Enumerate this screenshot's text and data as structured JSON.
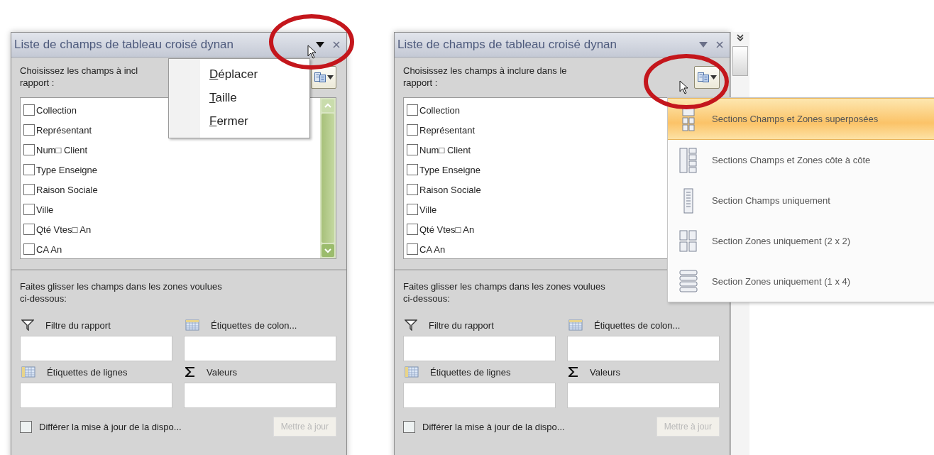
{
  "panels": [
    {
      "title": "Liste de champs de tableau croisé dynan",
      "intro_lines": [
        "Choisissez les champs à incl",
        "rapport :"
      ],
      "fields": [
        {
          "label": "Collection",
          "checked": false
        },
        {
          "label": "Représentant",
          "checked": false
        },
        {
          "label": "Num□ Client",
          "checked": false
        },
        {
          "label": "Type Enseigne",
          "checked": false
        },
        {
          "label": "Raison Sociale",
          "checked": false
        },
        {
          "label": "Ville",
          "checked": false
        },
        {
          "label": "Qté Vtes□ An",
          "checked": false
        },
        {
          "label": "CA An",
          "checked": false
        }
      ],
      "drag_hint_lines": [
        "Faites glisser les champs dans les zones voulues",
        "ci-dessous:"
      ],
      "zones": [
        {
          "kind": "filter",
          "label": "Filtre du rapport"
        },
        {
          "kind": "columns",
          "label": "Étiquettes de colon..."
        },
        {
          "kind": "rows",
          "label": "Étiquettes de lignes"
        },
        {
          "kind": "values",
          "label": "Valeurs"
        }
      ],
      "defer": {
        "label": "Différer la mise à jour de la dispo...",
        "checked": false
      },
      "update_button": {
        "label": "Mettre à jour",
        "disabled": true
      },
      "menu": {
        "kind": "window",
        "items": [
          {
            "label": "Déplacer"
          },
          {
            "label": "Taille"
          },
          {
            "label": "Fermer"
          }
        ]
      }
    },
    {
      "title": "Liste de champs de tableau croisé dynan",
      "intro_lines": [
        "Choisissez les champs à inclure dans le",
        "rapport :"
      ],
      "fields": [
        {
          "label": "Collection",
          "checked": false
        },
        {
          "label": "Représentant",
          "checked": false
        },
        {
          "label": "Num□ Client",
          "checked": false
        },
        {
          "label": "Type Enseigne",
          "checked": false
        },
        {
          "label": "Raison Sociale",
          "checked": false
        },
        {
          "label": "Ville",
          "checked": false
        },
        {
          "label": "Qté Vtes□ An",
          "checked": false
        },
        {
          "label": "CA An",
          "checked": false
        }
      ],
      "drag_hint_lines": [
        "Faites glisser les champs dans les zones voulues",
        "ci-dessous:"
      ],
      "zones": [
        {
          "kind": "filter",
          "label": "Filtre du rapport"
        },
        {
          "kind": "columns",
          "label": "Étiquettes de colon..."
        },
        {
          "kind": "rows",
          "label": "Étiquettes de lignes"
        },
        {
          "kind": "values",
          "label": "Valeurs"
        }
      ],
      "defer": {
        "label": "Différer la mise à jour de la dispo...",
        "checked": false
      },
      "update_button": {
        "label": "Mettre à jour",
        "disabled": true
      },
      "menu": {
        "kind": "layout",
        "items": [
          {
            "label": "Sections Champs et Zones superposées",
            "selected": true
          },
          {
            "label": "Sections Champs et Zones côte à côte",
            "selected": false
          },
          {
            "label": "Section Champs uniquement",
            "selected": false
          },
          {
            "label": "Section Zones uniquement (2 x 2)",
            "selected": false
          },
          {
            "label": "Section Zones uniquement (1 x 4)",
            "selected": false
          }
        ]
      }
    }
  ]
}
